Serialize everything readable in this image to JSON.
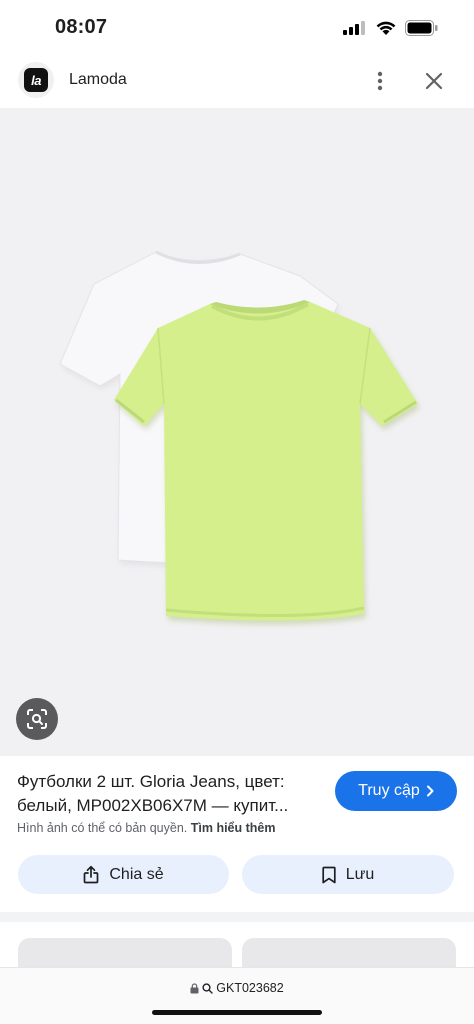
{
  "status_bar": {
    "time": "08:07"
  },
  "header": {
    "logo_text": "la",
    "site_name": "Lamoda"
  },
  "product": {
    "title_line1": "Футболки 2 шт. Gloria Jeans, цвет:",
    "title_line2": "белый, MP002XB06X7M — купит...",
    "visit_label": "Truy cập",
    "copyright_text": "Hình ảnh có thể có bản quyền.",
    "learn_more": "Tìm hiểu thêm"
  },
  "actions": {
    "share_label": "Chia sẻ",
    "save_label": "Lưu"
  },
  "bottom_bar": {
    "url": "GKT023682"
  },
  "colors": {
    "accent": "#1a73e8",
    "tshirt_green": "#d4f08a",
    "tshirt_white": "#f7f7f9",
    "chip_bg": "#e8f0fe"
  }
}
